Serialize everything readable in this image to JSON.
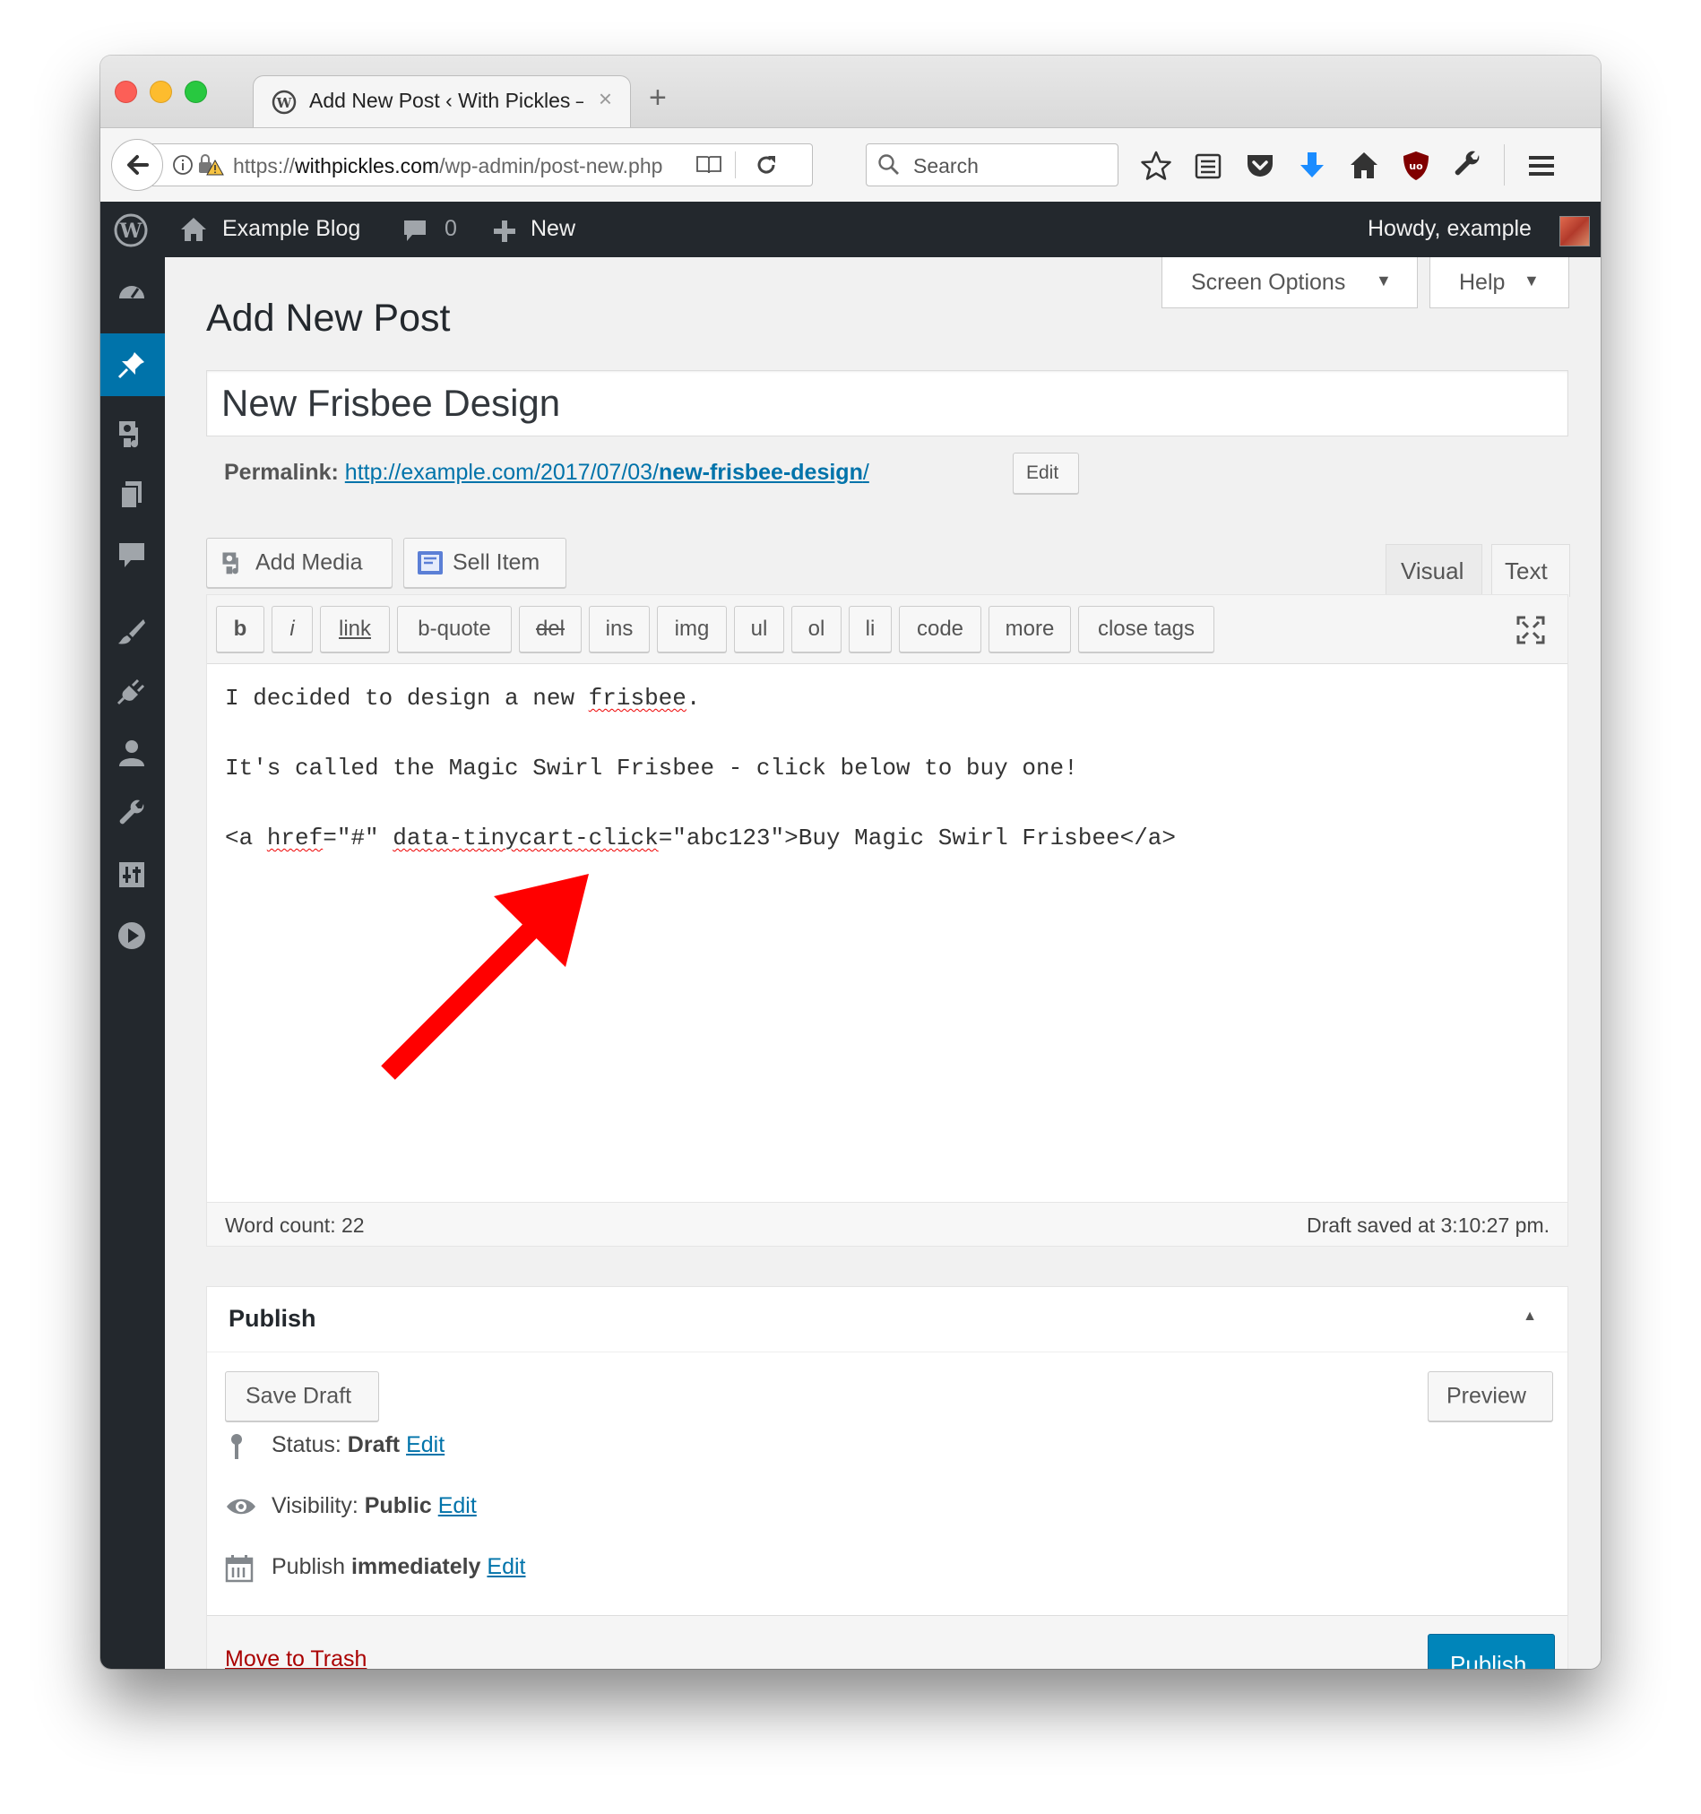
{
  "browser": {
    "tab_title": "Add New Post ‹ With Pickles — WordPress",
    "url_scheme": "https://",
    "url_host": "withpickles.com",
    "url_path": "/wp-admin/post-new.php",
    "search_placeholder": "Search"
  },
  "adminbar": {
    "site_name": "Example Blog",
    "comments_count": "0",
    "new_label": "New",
    "howdy": "Howdy, example"
  },
  "header": {
    "screen_options": "Screen Options",
    "help": "Help",
    "page_title": "Add New Post"
  },
  "post": {
    "title": "New Frisbee Design",
    "permalink_label": "Permalink:",
    "permalink_base": "http://example.com/2017/07/03/",
    "permalink_slug": "new-frisbee-design",
    "permalink_end": "/",
    "permalink_edit": "Edit"
  },
  "media_buttons": {
    "add_media": "Add Media",
    "sell_item": "Sell Item"
  },
  "editor_tabs": {
    "visual": "Visual",
    "text": "Text",
    "active": "Text"
  },
  "quicktags": [
    "b",
    "i",
    "link",
    "b-quote",
    "del",
    "ins",
    "img",
    "ul",
    "ol",
    "li",
    "code",
    "more",
    "close tags"
  ],
  "content": {
    "line1_a": "I decided to design a new ",
    "line1_b": "frisbee",
    "line1_c": ".",
    "line2": "It's called the Magic Swirl Frisbee - click below to buy one!",
    "line3_a": "<a ",
    "line3_b": "href",
    "line3_c": "=\"#\" ",
    "line3_d": "data-tinycart-click",
    "line3_e": "=\"abc123\">Buy Magic Swirl Frisbee</a>"
  },
  "status": {
    "word_count": "Word count: 22",
    "draft_saved": "Draft saved at 3:10:27 pm."
  },
  "publish": {
    "heading": "Publish",
    "save_draft": "Save Draft",
    "preview": "Preview",
    "status_label": "Status:",
    "status_value": "Draft",
    "visibility_label": "Visibility:",
    "visibility_value": "Public",
    "publish_label": "Publish",
    "publish_value": "immediately",
    "edit": "Edit",
    "move_to_trash": "Move to Trash",
    "publish_button": "Publish"
  },
  "colors": {
    "wp_dark": "#23282d",
    "wp_blue": "#0073aa",
    "annotation_arrow": "#ff0000",
    "trash_red": "#a00"
  }
}
